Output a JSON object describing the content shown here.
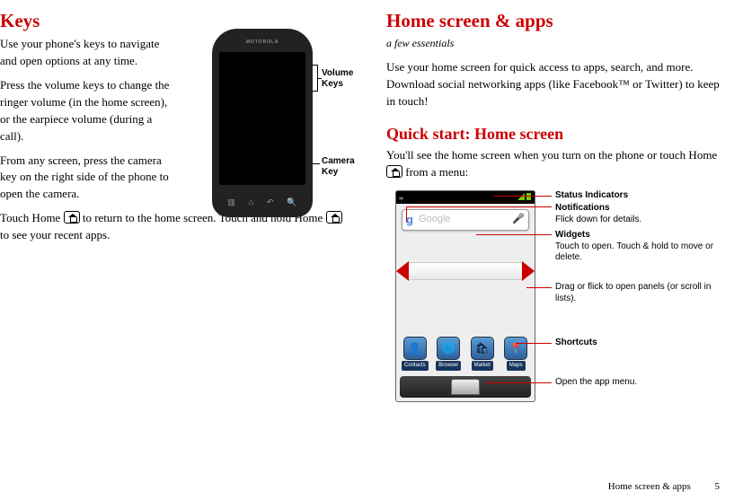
{
  "left": {
    "title": "Keys",
    "p1": "Use your phone's keys to navigate and open options at any time.",
    "p2": "Press the volume keys to change the ringer volume (in the home screen), or the earpiece volume (during a call).",
    "p3": "From any screen, press the camera key on the right side of the phone to open the camera.",
    "p4a": "Touch Home ",
    "p4b": " to return to the home screen. Touch and hold Home ",
    "p4c": " to see your recent apps.",
    "callouts": {
      "volume": "Volume Keys",
      "camera": "Camera Key"
    },
    "phone_brand": "MOTOROLA"
  },
  "right": {
    "title": "Home screen & apps",
    "tagline": "a few essentials",
    "intro": "Use your home screen for quick access to apps, search, and more. Download social networking apps (like Facebook™ or Twitter) to keep in touch!",
    "sub": "Quick start: Home screen",
    "sub_p_a": "You'll see the home screen when you turn on the phone or touch Home ",
    "sub_p_b": " from a menu:",
    "callouts": {
      "status": "Status Indicators",
      "notifications_b": "Notifications",
      "notifications_t": "Flick down for details.",
      "widgets_b": "Widgets",
      "widgets_t": "Touch to open. Touch & hold to move or delete.",
      "drag": "Drag or flick to open panels (or scroll in lists).",
      "shortcuts": "Shortcuts",
      "appmenu": "Open the app menu."
    },
    "search_placeholder": "Google",
    "shortcuts": [
      "Contacts",
      "Browser",
      "Market",
      "Maps"
    ]
  },
  "footer": {
    "section": "Home screen & apps",
    "page": "5"
  }
}
